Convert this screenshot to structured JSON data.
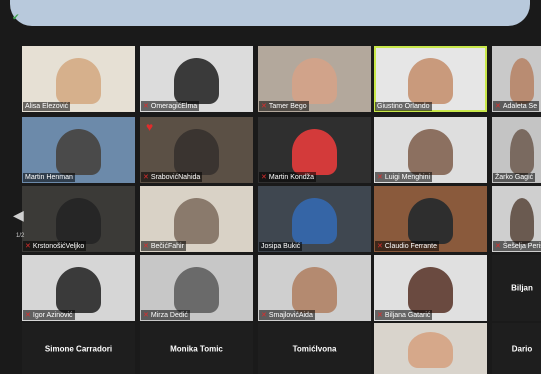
{
  "top": {
    "status_icon": "check-icon"
  },
  "nav": {
    "prev_icon": "chevron-left-icon",
    "page": "1/2"
  },
  "participants": [
    {
      "name": "Alisa Elezović",
      "muted": false,
      "bg": "#e6e0d4",
      "fg": "#d6b08c"
    },
    {
      "name": "OmeragićElma",
      "muted": true,
      "bg": "#dcdcdc",
      "fg": "#3a3a3a"
    },
    {
      "name": "Tamer Bego",
      "muted": true,
      "bg": "#b3a89c",
      "fg": "#d1a38a"
    },
    {
      "name": "Giustino Orlando",
      "muted": false,
      "bg": "#e6e6e6",
      "fg": "#c99a7c"
    },
    {
      "name": "Adaleta Se",
      "muted": true,
      "bg": "#c9c9c9",
      "fg": "#b98c72"
    },
    {
      "name": "Martin Henman",
      "muted": false,
      "bg": "#6c8aaa",
      "fg": "#4a4a4a"
    },
    {
      "name": "SrabovićNahida",
      "muted": true,
      "bg": "#5b5045",
      "fg": "#3a3430"
    },
    {
      "name": "Martin Kondža",
      "muted": true,
      "bg": "#2f2f2f",
      "fg": "#d33a3a"
    },
    {
      "name": "Luigi Menghini",
      "muted": true,
      "bg": "#dedede",
      "fg": "#8c7060"
    },
    {
      "name": "Žarko Gagić",
      "muted": false,
      "bg": "#c4c4c4",
      "fg": "#7a6a60"
    },
    {
      "name": "KrstonošićVeljko",
      "muted": true,
      "bg": "#3b3a37",
      "fg": "#262626"
    },
    {
      "name": "BečićFahir",
      "muted": true,
      "bg": "#d9d2c6",
      "fg": "#8a7a6c"
    },
    {
      "name": "Josipa Bukić",
      "muted": false,
      "bg": "#3f4750",
      "fg": "#3565a6"
    },
    {
      "name": "Claudio Ferrante",
      "muted": true,
      "bg": "#8a5a3c",
      "fg": "#2e2e2e"
    },
    {
      "name": "Šešelja Perišić",
      "muted": true,
      "bg": "#cfcfcf",
      "fg": "#6a5a50"
    },
    {
      "name": "Igor Azinović",
      "muted": true,
      "bg": "#d6d6d6",
      "fg": "#3a3a3a"
    },
    {
      "name": "Mirza Dedić",
      "muted": true,
      "bg": "#c7c7c7",
      "fg": "#6a6a6a"
    },
    {
      "name": "SmajlovićAida",
      "muted": true,
      "bg": "#cfcfcf",
      "fg": "#b48a70"
    },
    {
      "name": "Biljana Gatarić",
      "muted": true,
      "bg": "#e0e0e0",
      "fg": "#6a4a40"
    },
    {
      "name": "Biljan",
      "muted": true,
      "bg": "#1e1e1e",
      "fg": "",
      "blank": true
    },
    {
      "name": "Simone Carradori",
      "muted": false,
      "bg": "#1e1e1e",
      "fg": "",
      "blank": true
    },
    {
      "name": "Monika Tomic",
      "muted": false,
      "bg": "#1e1e1e",
      "fg": "",
      "blank": true
    },
    {
      "name": "TomićIvona",
      "muted": false,
      "bg": "#1e1e1e",
      "fg": "",
      "blank": true
    },
    {
      "name": "",
      "muted": false,
      "bg": "#d9d4cc",
      "fg": "#d6a88a"
    },
    {
      "name": "Dario",
      "muted": false,
      "bg": "#1e1e1e",
      "fg": "",
      "blank": true
    }
  ]
}
